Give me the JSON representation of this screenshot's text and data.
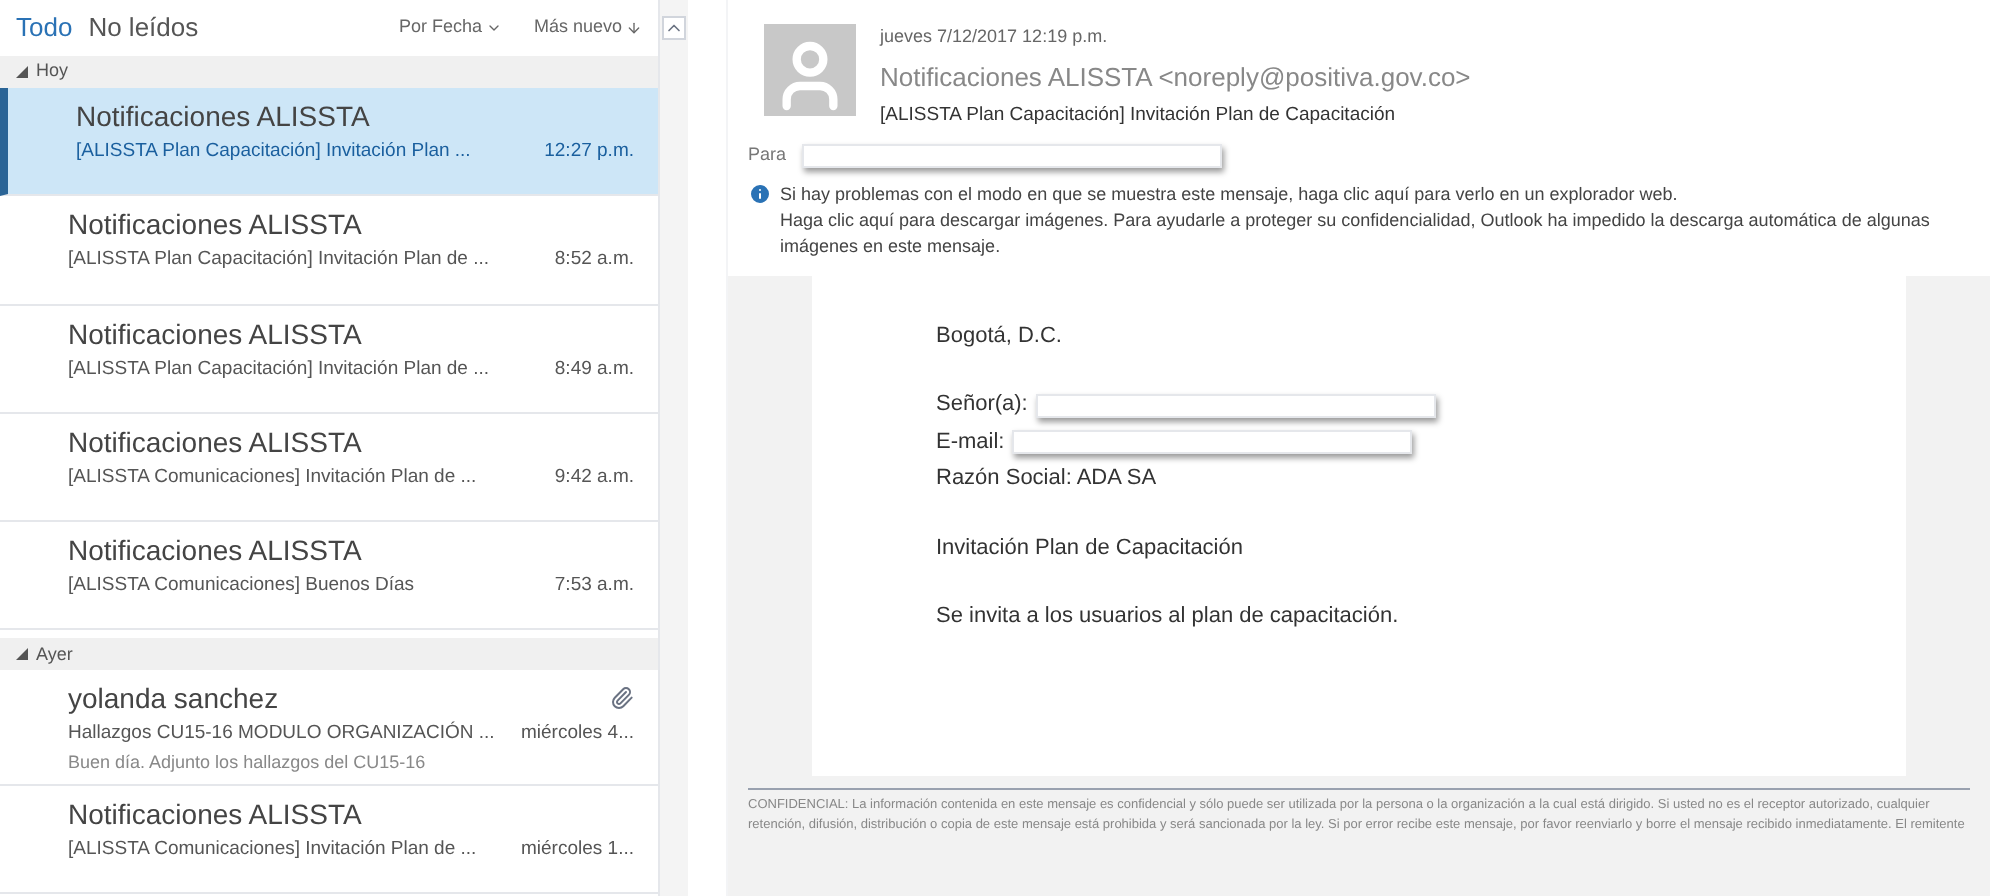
{
  "filters": [
    {
      "label": "Todo",
      "selected": true
    },
    {
      "label": "No leídos",
      "selected": false
    }
  ],
  "sort": {
    "by": "Por Fecha",
    "order": "Más nuevo"
  },
  "groups": [
    {
      "label": "Hoy",
      "messages": [
        {
          "sender": "Notificaciones ALISSTA",
          "subject": "[ALISSTA Plan Capacitación] Invitación Plan ...",
          "time": "12:27 p.m.",
          "selected": true,
          "attachment": false
        },
        {
          "sender": "Notificaciones ALISSTA",
          "subject": "[ALISSTA Plan Capacitación] Invitación Plan de ...",
          "time": "8:52 a.m.",
          "selected": false,
          "attachment": false
        },
        {
          "sender": "Notificaciones ALISSTA",
          "subject": "[ALISSTA Plan Capacitación] Invitación Plan de ...",
          "time": "8:49 a.m.",
          "selected": false,
          "attachment": false
        },
        {
          "sender": "Notificaciones ALISSTA",
          "subject": "[ALISSTA Comunicaciones] Invitación Plan de ...",
          "time": "9:42 a.m.",
          "selected": false,
          "attachment": false
        },
        {
          "sender": "Notificaciones ALISSTA",
          "subject": "[ALISSTA Comunicaciones] Buenos Días",
          "time": "7:53 a.m.",
          "selected": false,
          "attachment": false
        }
      ]
    },
    {
      "label": "Ayer",
      "messages": [
        {
          "sender": "yolanda sanchez",
          "subject": "Hallazgos CU15-16 MODULO ORGANIZACIÓN ...",
          "time": "miércoles 4...",
          "preview": "Buen día. Adjunto los hallazgos del CU15-16",
          "selected": false,
          "attachment": true
        },
        {
          "sender": "Notificaciones ALISSTA",
          "subject": "[ALISSTA Comunicaciones] Invitación Plan de ...",
          "time": "miércoles 1...",
          "selected": false,
          "attachment": false
        }
      ]
    }
  ],
  "reading_pane": {
    "date": "jueves 7/12/2017 12:19 p.m.",
    "from": "Notificaciones ALISSTA <noreply@positiva.gov.co>",
    "subject": "[ALISSTA Plan Capacitación] Invitación Plan de Capacitación",
    "to_label": "Para",
    "info": [
      "Si hay problemas con el modo en que se muestra este mensaje, haga clic aquí para verlo en un explorador web.",
      "Haga clic aquí para descargar imágenes. Para ayudarle a proteger su confidencialidad, Outlook ha impedido la descarga automática de algunas imágenes en este mensaje."
    ],
    "body": [
      [
        {
          "text": "Bogotá, D.C.",
          "redacted": false
        }
      ],
      [
        {
          "text": "Señor(a):",
          "redacted": true
        },
        {
          "text": "E-mail:",
          "redacted": true
        },
        {
          "text": "Razón Social: ADA SA",
          "redacted": false
        }
      ],
      [
        {
          "text": "Invitación Plan de Capacitación",
          "redacted": false
        }
      ],
      [
        {
          "text": "Se invita a los usuarios al plan de capacitación.",
          "redacted": false
        }
      ]
    ],
    "disclaimer": "CONFIDENCIAL: La información contenida en este mensaje es confidencial y sólo puede ser utilizada por la persona o la organización a la cual está dirigido. Si usted no es el receptor autorizado, cualquier retención, difusión, distribución o copia de este mensaje está prohibida y será sancionada por la ley. Si por error recibe este mensaje, por favor reenviarlo y borre el mensaje recibido inmediatamente. El remitente"
  }
}
